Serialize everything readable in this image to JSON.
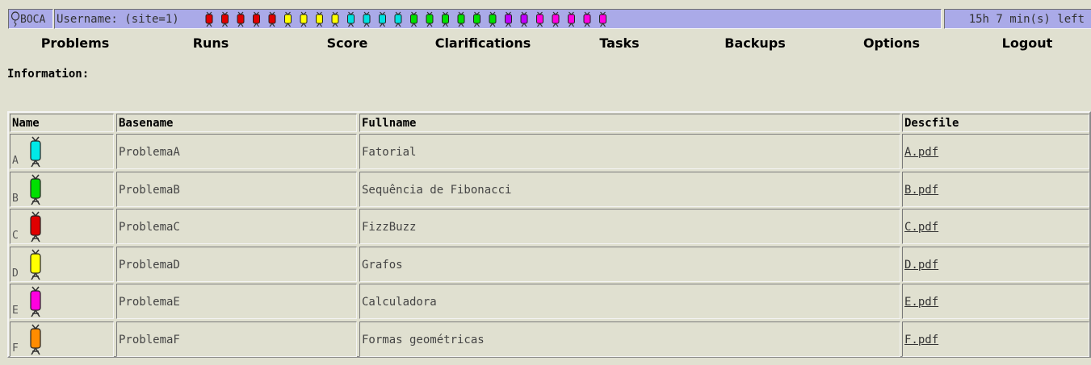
{
  "header": {
    "logo_text": "BOCA",
    "username_label": "Username: (site=1)",
    "time_left": "15h 7 min(s) left",
    "balloon_colors": [
      "#e00000",
      "#e00000",
      "#e00000",
      "#e00000",
      "#e00000",
      "#ffff00",
      "#ffff00",
      "#ffff00",
      "#ffff00",
      "#00e0e0",
      "#00e0e0",
      "#00e0e0",
      "#00e0e0",
      "#00e000",
      "#00e000",
      "#00e000",
      "#00e000",
      "#00e000",
      "#00e000",
      "#c000ff",
      "#c000ff",
      "#ff00e0",
      "#ff00e0",
      "#ff00e0",
      "#ff00e0",
      "#ff00e0",
      "#ff8c00"
    ]
  },
  "menu": {
    "problems": "Problems",
    "runs": "Runs",
    "score": "Score",
    "clarifications": "Clarifications",
    "tasks": "Tasks",
    "backups": "Backups",
    "options": "Options",
    "logout": "Logout"
  },
  "information_label": "Information:",
  "table": {
    "headers": {
      "name": "Name",
      "basename": "Basename",
      "fullname": "Fullname",
      "descfile": "Descfile"
    },
    "rows": [
      {
        "name": "A",
        "balloon": "#00e8e8",
        "basename": "ProblemaA",
        "fullname": "Fatorial",
        "descfile": "A.pdf"
      },
      {
        "name": "B",
        "balloon": "#00e000",
        "basename": "ProblemaB",
        "fullname": "Sequência de Fibonacci",
        "descfile": "B.pdf"
      },
      {
        "name": "C",
        "balloon": "#e00000",
        "basename": "ProblemaC",
        "fullname": "FizzBuzz",
        "descfile": "C.pdf"
      },
      {
        "name": "D",
        "balloon": "#ffff00",
        "basename": "ProblemaD",
        "fullname": "Grafos",
        "descfile": "D.pdf"
      },
      {
        "name": "E",
        "balloon": "#ff00e0",
        "basename": "ProblemaE",
        "fullname": "Calculadora",
        "descfile": "E.pdf"
      },
      {
        "name": "F",
        "balloon": "#ff8c00",
        "basename": "ProblemaF",
        "fullname": "Formas geométricas",
        "descfile": "F.pdf"
      }
    ]
  }
}
